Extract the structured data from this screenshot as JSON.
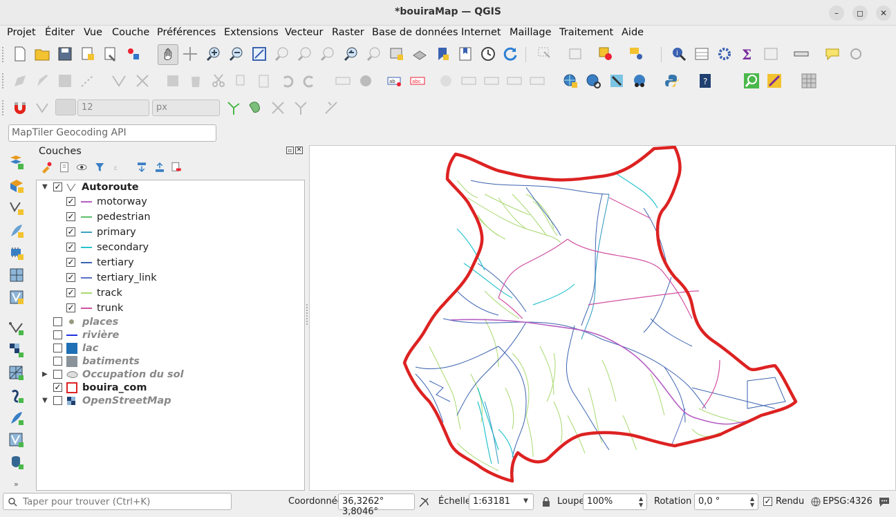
{
  "window": {
    "title": "*bouiraMap — QGIS",
    "minimize": "–",
    "maximize": "◻",
    "close": "✕"
  },
  "menu": [
    "Projet",
    "Éditer",
    "Vue",
    "Couche",
    "Préférences",
    "Extensions",
    "Vecteur",
    "Raster",
    "Base de données",
    "Internet",
    "Maillage",
    "Traitement",
    "Aide"
  ],
  "snapping": {
    "tolerance_value": "12",
    "unit": "px"
  },
  "geocoding": {
    "placeholder": "MapTiler Geocoding API"
  },
  "layers_panel": {
    "title": "Couches",
    "layers": [
      {
        "name": "Autoroute",
        "checked": true,
        "expanded": true,
        "style": "bold"
      },
      {
        "name": "motorway",
        "checked": true,
        "color": "#b55ec2"
      },
      {
        "name": "pedestrian",
        "checked": true,
        "color": "#5cbf6a"
      },
      {
        "name": "primary",
        "checked": true,
        "color": "#3b9fc4"
      },
      {
        "name": "secondary",
        "checked": true,
        "color": "#26c2cf"
      },
      {
        "name": "tertiary",
        "checked": true,
        "color": "#3a62b0"
      },
      {
        "name": "tertiary_link",
        "checked": true,
        "color": "#5a6fc9"
      },
      {
        "name": "track",
        "checked": true,
        "color": "#a8d86e"
      },
      {
        "name": "trunk",
        "checked": true,
        "color": "#d14fa0"
      },
      {
        "name": "places",
        "checked": false,
        "style": "italic"
      },
      {
        "name": "rivière",
        "checked": false,
        "style": "italic"
      },
      {
        "name": "lac",
        "checked": false,
        "style": "italic"
      },
      {
        "name": "batiments",
        "checked": false,
        "style": "italic"
      },
      {
        "name": "Occupation du sol",
        "checked": false,
        "style": "italic"
      },
      {
        "name": "bouira_com",
        "checked": true,
        "style": "bold"
      },
      {
        "name": "OpenStreetMap",
        "checked": false,
        "style": "italic"
      }
    ]
  },
  "status": {
    "search_placeholder": "Taper pour trouver (Ctrl+K)",
    "coord_label": "Coordonnée",
    "coord_value": "36,3262° 3,8046°",
    "scale_label": "Échelle",
    "scale_value": "1:63181",
    "magnifier_label": "Loupe",
    "magnifier_value": "100%",
    "rotation_label": "Rotation",
    "rotation_value": "0,0 °",
    "render_label": "Rendu",
    "render_checked": true,
    "crs": "EPSG:4326"
  },
  "colors": {
    "boundary": "#dd2222",
    "accent": "#3a62b0"
  }
}
